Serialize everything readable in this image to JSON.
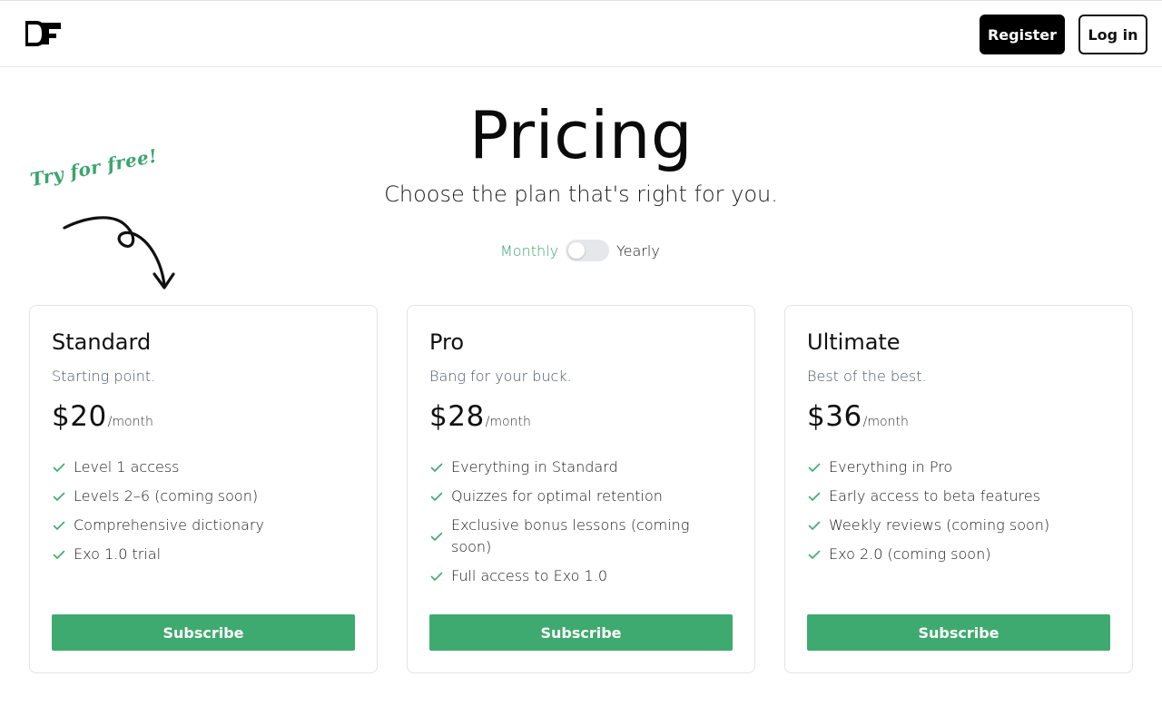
{
  "header": {
    "logo_icon": "df-logo-icon",
    "register_label": "Register",
    "login_label": "Log in"
  },
  "hero": {
    "title": "Pricing",
    "subtitle": "Choose the plan that's right for you.",
    "callout": "Try for free!"
  },
  "billing_toggle": {
    "monthly_label": "Monthly",
    "yearly_label": "Yearly",
    "selected": "Monthly"
  },
  "colors": {
    "accent": "#3faa6f",
    "dark": "#000000"
  },
  "plans": [
    {
      "name": "Standard",
      "tagline": "Starting point.",
      "price": "$20",
      "period": "/month",
      "features": [
        "Level 1 access",
        "Levels 2–6 (coming soon)",
        "Comprehensive dictionary",
        "Exo 1.0 trial"
      ],
      "button_label": "Subscribe"
    },
    {
      "name": "Pro",
      "tagline": "Bang for your buck.",
      "price": "$28",
      "period": "/month",
      "features": [
        "Everything in Standard",
        "Quizzes for optimal retention",
        "Exclusive bonus lessons (coming soon)",
        "Full access to Exo 1.0"
      ],
      "button_label": "Subscribe"
    },
    {
      "name": "Ultimate",
      "tagline": "Best of the best.",
      "price": "$36",
      "period": "/month",
      "features": [
        "Everything in Pro",
        "Early access to beta features",
        "Weekly reviews (coming soon)",
        "Exo 2.0 (coming soon)"
      ],
      "button_label": "Subscribe"
    }
  ]
}
